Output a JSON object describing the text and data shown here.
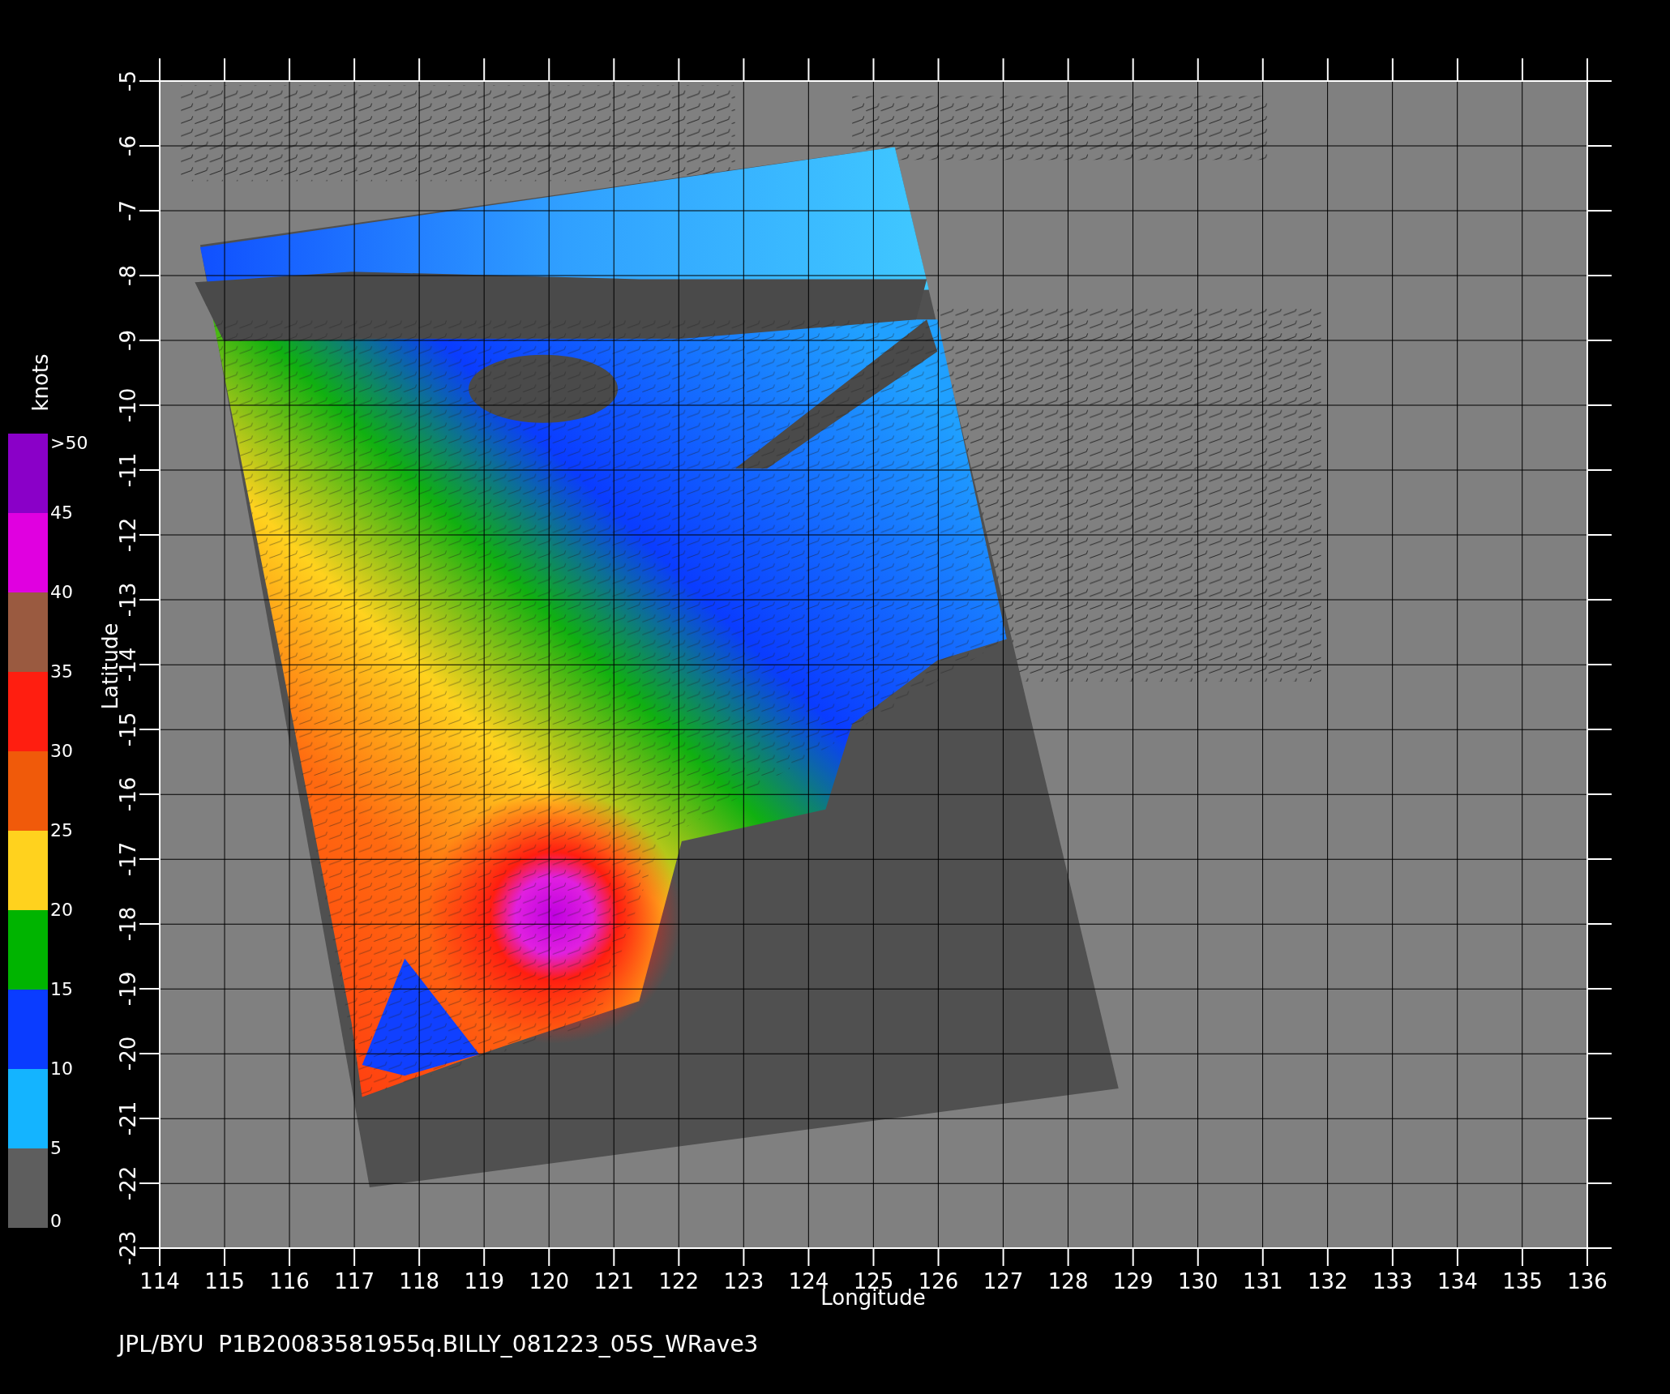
{
  "colorbar": {
    "unit": "knots",
    "segments": [
      {
        "color": "#8a00c8"
      },
      {
        "color": "#e000e0"
      },
      {
        "color": "#9a5a40"
      },
      {
        "color": "#ff1e10"
      },
      {
        "color": "#f05a0a"
      },
      {
        "color": "#ffd21e"
      },
      {
        "color": "#00b400"
      },
      {
        "color": "#0a3cff"
      },
      {
        "color": "#14b4ff"
      },
      {
        "color": "#5e5e5e"
      }
    ],
    "labels": [
      ">50",
      "45",
      "40",
      "35",
      "30",
      "25",
      "20",
      "15",
      "10",
      "5",
      "0"
    ]
  },
  "plot": {
    "ylabel": "Latitude",
    "xlabel": "Longitude",
    "yticks": [
      "-5",
      "-6",
      "-7",
      "-8",
      "-9",
      "-10",
      "-11",
      "-12",
      "-13",
      "-14",
      "-15",
      "-16",
      "-17",
      "-18",
      "-19",
      "-20",
      "-21",
      "-22",
      "-23"
    ],
    "xticks": [
      "114",
      "115",
      "116",
      "117",
      "118",
      "119",
      "120",
      "121",
      "122",
      "123",
      "124",
      "125",
      "126",
      "127",
      "128",
      "129",
      "130",
      "131",
      "132",
      "133",
      "134",
      "135",
      "136"
    ]
  },
  "caption": "JPL/BYU  P1B20083581955q.BILLY_081223_05S_WRave3"
}
